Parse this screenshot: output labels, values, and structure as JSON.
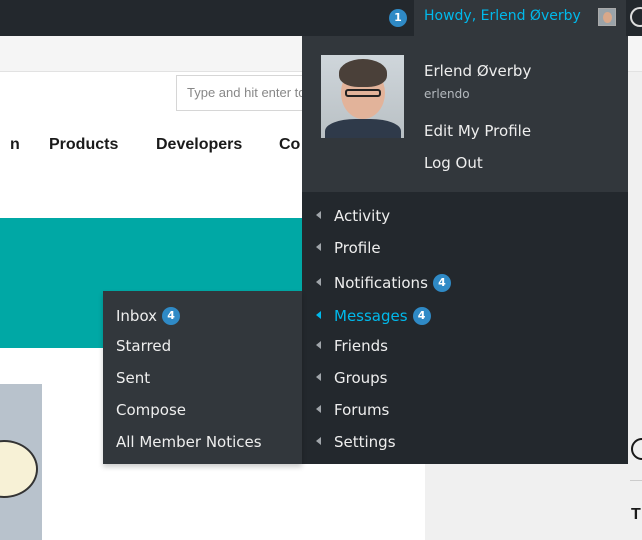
{
  "admin_bar": {
    "notification_count": "1",
    "howdy": "Howdy, Erlend Øverby"
  },
  "site": {
    "search_placeholder": "Type and hit enter to search",
    "nav": [
      "n",
      "Products",
      "Developers",
      "Co"
    ]
  },
  "user": {
    "display_name": "Erlend Øverby",
    "username": "erlendo",
    "edit_profile": "Edit My Profile",
    "log_out": "Log Out"
  },
  "menu": {
    "items": [
      {
        "label": "Activity",
        "count": null
      },
      {
        "label": "Profile",
        "count": null
      },
      {
        "label": "Notifications",
        "count": "4"
      },
      {
        "label": "Messages",
        "count": "4"
      },
      {
        "label": "Friends",
        "count": null
      },
      {
        "label": "Groups",
        "count": null
      },
      {
        "label": "Forums",
        "count": null
      },
      {
        "label": "Settings",
        "count": null
      }
    ]
  },
  "messages_submenu": {
    "items": [
      {
        "label": "Inbox",
        "count": "4"
      },
      {
        "label": "Starred",
        "count": null
      },
      {
        "label": "Sent",
        "count": null
      },
      {
        "label": "Compose",
        "count": null
      },
      {
        "label": "All Member Notices",
        "count": null
      }
    ]
  },
  "colors": {
    "admin_bar": "#23282d",
    "dropdown": "#32373c",
    "accent": "#00b9eb",
    "badge": "#2f8ac6",
    "banner": "#00a8a5"
  }
}
